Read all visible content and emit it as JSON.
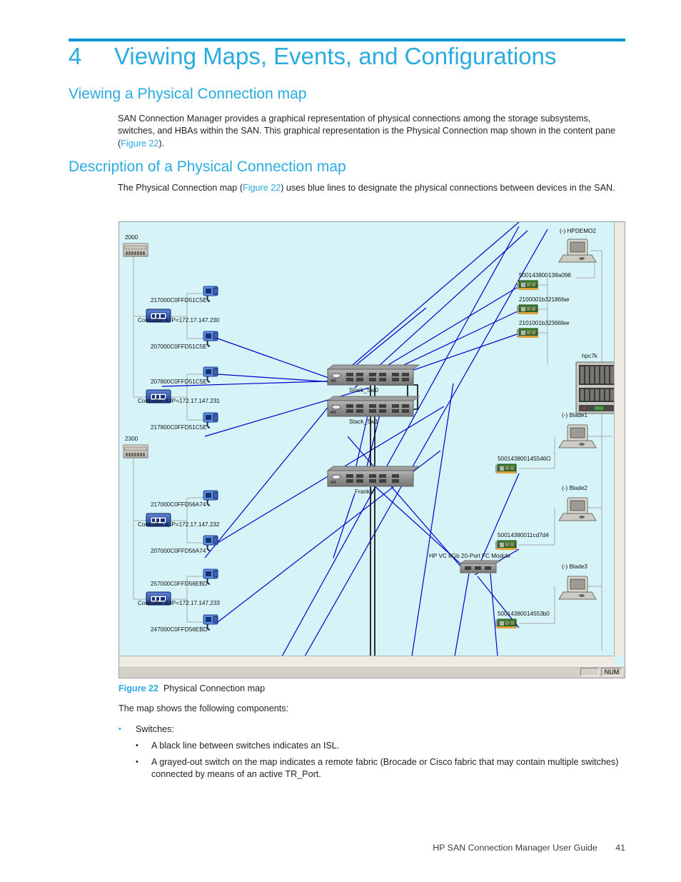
{
  "chapter": {
    "number": "4",
    "title": "Viewing Maps, Events, and Configurations"
  },
  "sections": [
    {
      "heading": "Viewing a Physical Connection map"
    },
    {
      "heading": "Description of a Physical Connection map"
    }
  ],
  "paragraphs": {
    "intro_a": "SAN Connection Manager provides a graphical representation of physical connections among the storage subsystems, switches, and HBAs within the SAN. This graphical representation is the Physical Connection map shown in the content pane (",
    "intro_a_xref": "Figure 22",
    "intro_a_end": ").",
    "intro_b": "The Physical Connection map (",
    "intro_b_xref": "Figure 22",
    "intro_b_end": ") uses blue lines to designate the physical connections between devices in the SAN."
  },
  "figure": {
    "label": "Figure 22",
    "caption": "Physical Connection map",
    "status_bar": {
      "num_indicator": "NUM"
    },
    "background_color": "#d6f4f7",
    "link_color": "#0000cc",
    "isl_color": "#000000",
    "map": {
      "arrays": [
        {
          "name": "2000"
        },
        {
          "name": "2300"
        }
      ],
      "controllers": [
        {
          "label": "Controller A;IP=172.17.147.230"
        },
        {
          "label": "Controller B;IP=172.17.147.231"
        },
        {
          "label": "Controller A;IP=172.17.147.232"
        },
        {
          "label": "Controller B;IP=172.17.147.233"
        }
      ],
      "array_ports": [
        {
          "wwn": "217000C0FFD51C5E"
        },
        {
          "wwn": "207000C0FFD51C5E"
        },
        {
          "wwn": "207800C0FFD51C5E"
        },
        {
          "wwn": "217800C0FFD51C5E"
        },
        {
          "wwn": "217000C0FFD56A74"
        },
        {
          "wwn": "207000C0FFD56A74"
        },
        {
          "wwn": "257000C0FFD56EBD"
        },
        {
          "wwn": "247000C0FFD56EBD"
        }
      ],
      "switches": [
        {
          "name": "Stack_Sw0"
        },
        {
          "name": "Stack_Sw1"
        },
        {
          "name": "Franklin"
        },
        {
          "name": "HP VC 8Gb 20-Port FC Module"
        }
      ],
      "hosts": [
        {
          "name": "(-) HPDEMO2"
        },
        {
          "name": "(-) Blade1"
        },
        {
          "name": "(-) Blade2"
        },
        {
          "name": "(-) Blade3"
        }
      ],
      "enclosure": {
        "name": "hpc7k"
      },
      "hba_ports": [
        {
          "wwn": "500143800138a098"
        },
        {
          "wwn": "2100001b32186fae"
        },
        {
          "wwn": "2101001b32366fee"
        },
        {
          "wwn": "500143800145546O"
        },
        {
          "wwn": "50014380011cd7d4"
        },
        {
          "wwn": "50014380014553b0"
        }
      ]
    }
  },
  "after_figure": {
    "lead_in": "The map shows the following components:",
    "bullets": [
      {
        "text": "Switches:"
      },
      {
        "text": "A black line between switches indicates an ISL."
      },
      {
        "text": "A grayed-out switch on the map indicates a remote fabric (Brocade or Cisco fabric that may contain multiple switches) connected by means of an active TR_Port."
      }
    ]
  },
  "footer": {
    "guide": "HP SAN Connection Manager User Guide",
    "page": "41"
  }
}
